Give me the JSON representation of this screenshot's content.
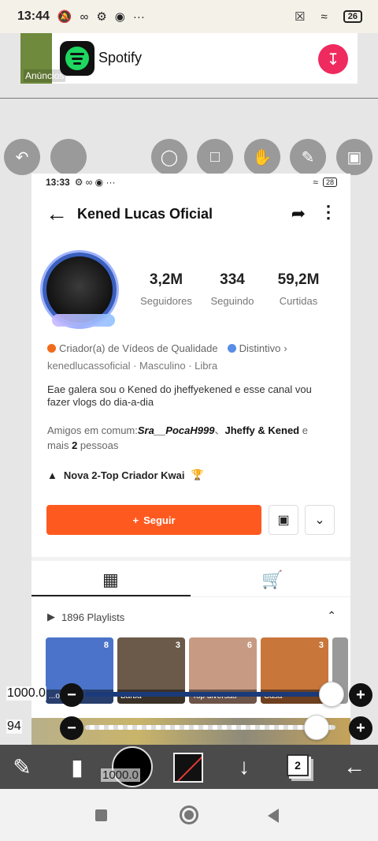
{
  "outer_status": {
    "time": "13:44",
    "battery": "26"
  },
  "ad": {
    "label": "Anúncios",
    "app_name": "Spotify"
  },
  "inner_status": {
    "time": "13:33",
    "battery": "28"
  },
  "profile": {
    "name": "Kened Lucas Oficial",
    "stats": [
      {
        "value": "3,2M",
        "label": "Seguidores"
      },
      {
        "value": "334",
        "label": "Seguindo"
      },
      {
        "value": "59,2M",
        "label": "Curtidas"
      }
    ],
    "credential": "Criador(a) de Vídeos de Qualidade",
    "distinctive": "Distintivo",
    "meta": "kenedlucassoficial · Masculino · Libra",
    "bio": "Eae galera sou o Kened do jheffyekened e esse canal vou fazer vlogs do dia-a-dia",
    "friends_prefix": "Amigos em comum:",
    "friend1": "Sra__PocaH",
    "friend1_suffix": "999",
    "friend2": "Jheffy & Kened",
    "friends_mid": " e",
    "friends_more_prefix": "mais ",
    "friends_more_count": "2",
    "friends_more_suffix": " pessoas",
    "creator_badge": "Nova 2-Top Criador Kwai",
    "follow_label": "Seguir",
    "playlists_label": "1896 Playlists",
    "playlists": [
      {
        "count": "8",
        "caption": "...o",
        "color": "#4a73c9"
      },
      {
        "count": "3",
        "caption": "Barba",
        "color": "#6b5a4a"
      },
      {
        "count": "6",
        "caption": "Top diversão",
        "color": "#c79a84"
      },
      {
        "count": "3",
        "caption": "Casa",
        "color": "#c8763a"
      },
      {
        "count": "",
        "caption": "",
        "color": "#999999"
      }
    ]
  },
  "sliders": [
    {
      "value_text": "1000.0",
      "level": 1.0
    },
    {
      "value_text": "94",
      "level": 0.94
    }
  ],
  "paint_toolbar": {
    "brush_size_text": "1000.0",
    "layer_count": "2"
  }
}
